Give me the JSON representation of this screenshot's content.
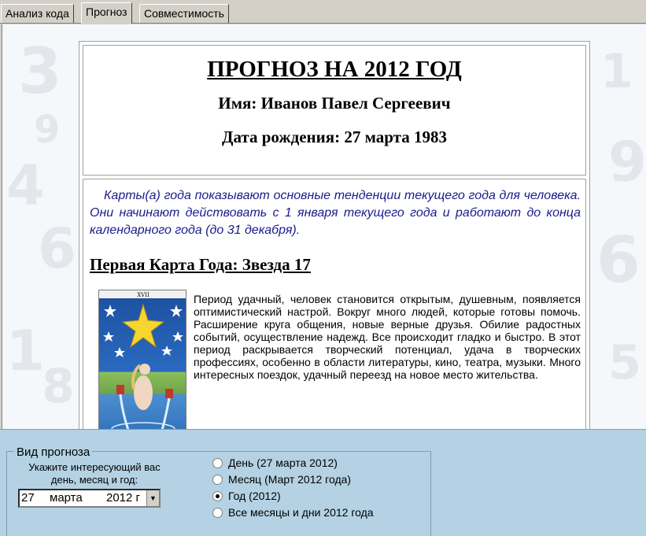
{
  "tabs": [
    {
      "label": "Анализ кода",
      "active": false
    },
    {
      "label": "Прогноз",
      "active": true
    },
    {
      "label": "Совместимость",
      "active": false
    }
  ],
  "header": {
    "title": "ПРОГНОЗ НА 2012 ГОД",
    "name_line": "Имя: Иванов Павел Сергеевич",
    "birth_line": "Дата рождения: 27 марта 1983"
  },
  "intro": "Карты(а) года показывают основные тенденции текущего года для человека. Они начинают действовать с 1 января текущего года и работают до конца календарного года (до 31 декабря).",
  "card": {
    "heading": "Первая Карта Года: Звезда 17",
    "image_label": "XVII",
    "description": "Период удачный, человек становится открытым, душевным, появляется оптимистический настрой. Вокруг много людей, которые готовы помочь. Расширение круга общения, новые верные друзья. Обилие радостных событий, осуществление надежд. Все происходит гладко и быстро. В этот период раскрывается творческий потенциал, удача в творческих профессиях, особенно в области литературы, кино, театра, музыки. Много интересных поездок, удачный переезд на новое место жительства."
  },
  "panel": {
    "legend": "Вид прогноза",
    "hint": "Укажите интересующий вас день, месяц и год:",
    "date": {
      "day": "27",
      "month": "марта",
      "year": "2012 г"
    },
    "options": [
      {
        "label": "День (27 марта 2012)",
        "selected": false
      },
      {
        "label": "Месяц (Март 2012 года)",
        "selected": false
      },
      {
        "label": "Год (2012)",
        "selected": true
      },
      {
        "label": "Все месяцы и дни 2012 года",
        "selected": false
      }
    ]
  },
  "colors": {
    "intro_text": "#1a1a8c",
    "panel_bg": "#b4d2e3",
    "content_bg": "#f5f8fb"
  }
}
